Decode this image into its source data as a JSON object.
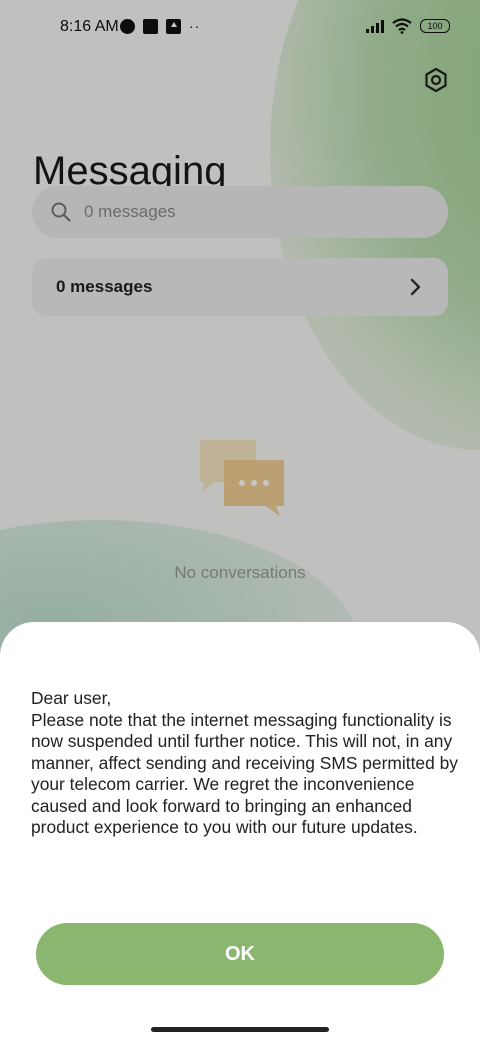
{
  "status_bar": {
    "time": "8:16 AM",
    "overflow_dots": "··",
    "battery": "100"
  },
  "header": {
    "title": "Messaging",
    "settings_icon": "settings-icon"
  },
  "search": {
    "placeholder": "0 messages"
  },
  "messages_card": {
    "label": "0 messages"
  },
  "empty_state": {
    "text": "No conversations"
  },
  "dialog": {
    "message": "Dear user,\nPlease note that the internet messaging functionality is now suspended until further notice. This will not, in any manner, affect sending and receiving SMS permitted by your telecom carrier. We regret the inconvenience caused and look forward to bringing an enhanced product experience to you with our future updates.",
    "ok_label": "OK"
  },
  "colors": {
    "accent": "#8ab66f",
    "background": "#f6f6f4",
    "sheet": "#ffffff"
  }
}
